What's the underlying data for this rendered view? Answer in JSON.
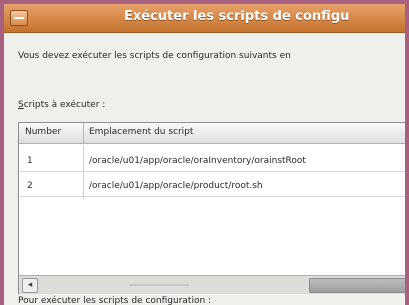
{
  "window": {
    "title": "Exécuter les scripts de configu"
  },
  "content": {
    "intro": "Vous devez exécuter les scripts de configuration suivants en",
    "section_label_mnemonic": "S",
    "section_label_rest": "cripts à exécuter :",
    "footer": "Pour exécuter les scripts de configuration :"
  },
  "table": {
    "headers": {
      "number": "Number",
      "path": "Emplacement du script"
    },
    "rows": [
      {
        "number": "1",
        "path": "/oracle/u01/app/oracle/oraInventory/orainstRoot"
      },
      {
        "number": "2",
        "path": "/oracle/u01/app/oracle/product/root.sh"
      }
    ]
  },
  "scrollbar": {
    "left_arrow": "◂"
  },
  "colors": {
    "frame": "#a7607d",
    "titlebar": "#d8874a",
    "window_bg": "#efefeb"
  }
}
